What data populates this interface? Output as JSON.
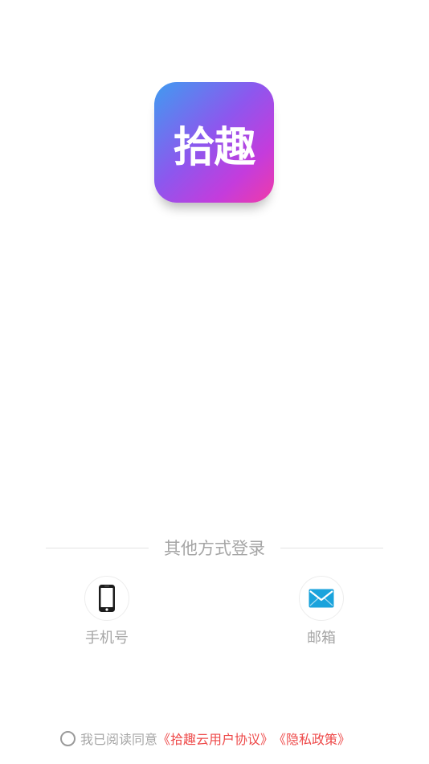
{
  "logo": {
    "text": "拾趣"
  },
  "other_login": {
    "title": "其他方式登录",
    "options": [
      {
        "label": "手机号",
        "icon": "phone-icon"
      },
      {
        "label": "邮箱",
        "icon": "mail-icon"
      }
    ]
  },
  "agreement": {
    "prefix": "我已阅读同意",
    "user_agreement": "《拾趣云用户协议》",
    "privacy_policy": "《隐私政策》"
  },
  "colors": {
    "link": "#ee4a4a",
    "muted_text": "#a6a6a6",
    "mail_icon": "#1aa3dc",
    "logo_gradient": [
      "#3f9cf0",
      "#8d57ee",
      "#f03aa8"
    ]
  }
}
